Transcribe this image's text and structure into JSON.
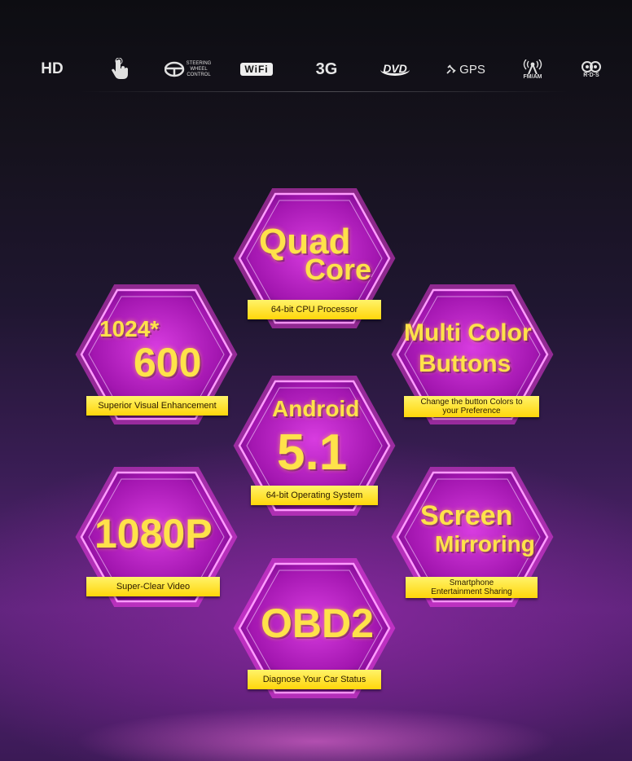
{
  "features": [
    {
      "label": "HD",
      "icon": "hd-icon"
    },
    {
      "label": "",
      "icon": "touch-hand-icon"
    },
    {
      "label": "STEERING WHEEL CONTROL",
      "icon": "steering-wheel-icon"
    },
    {
      "label": "WiFi",
      "icon": "wifi-icon"
    },
    {
      "label": "3G",
      "icon": "3g-icon"
    },
    {
      "label": "DVD",
      "icon": "dvd-icon"
    },
    {
      "label": "GPS",
      "icon": "gps-satellite-icon"
    },
    {
      "label": "FM/AM",
      "icon": "radio-antenna-icon"
    },
    {
      "label": "R·D·S",
      "icon": "rds-icon"
    }
  ],
  "hexes": {
    "quad": {
      "line1": "Quad",
      "line2": "Core",
      "ribbon": "64-bit CPU Processor"
    },
    "res": {
      "line1": "1024*",
      "line2": "600",
      "ribbon": "Superior Visual Enhancement"
    },
    "multicolor": {
      "line1": "Multi Color",
      "line2": "Buttons",
      "ribbon_a": "Change the button Colors to",
      "ribbon_b": "your Preference"
    },
    "android": {
      "line1": "Android",
      "line2": "5.1",
      "ribbon": "64-bit Operating System"
    },
    "p1080": {
      "big": "1080P",
      "ribbon": "Super-Clear Video"
    },
    "mirror": {
      "line1": "Screen",
      "line2": "Mirroring",
      "ribbon_a": "Smartphone",
      "ribbon_b": "Entertainment Sharing"
    },
    "obd": {
      "big": "OBD2",
      "ribbon": "Diagnose Your Car Status"
    }
  },
  "colors": {
    "hex_fill": "#c020c8",
    "hex_border": "#ff60ff",
    "text": "#ffe24a",
    "ribbon": "#ffe53a"
  }
}
